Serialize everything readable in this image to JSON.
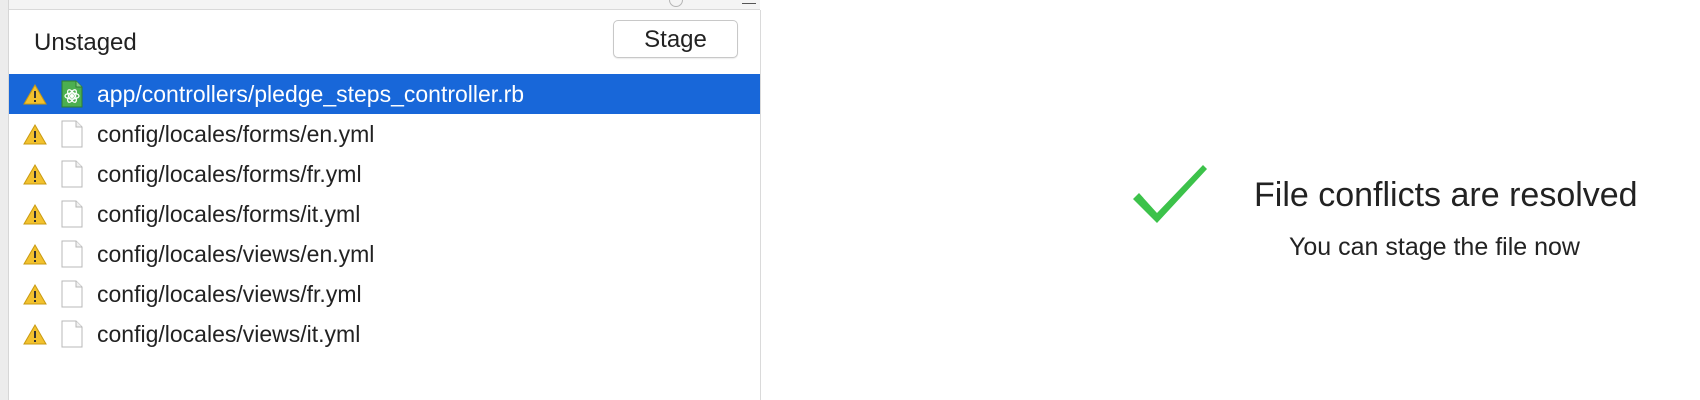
{
  "unstaged_panel": {
    "title": "Unstaged",
    "stage_button_label": "Stage",
    "files": [
      {
        "path": "app/controllers/pledge_steps_controller.rb",
        "status_icon": "warning-icon",
        "file_icon": "ruby-file-icon",
        "selected": true
      },
      {
        "path": "config/locales/forms/en.yml",
        "status_icon": "warning-icon",
        "file_icon": "file-icon",
        "selected": false
      },
      {
        "path": "config/locales/forms/fr.yml",
        "status_icon": "warning-icon",
        "file_icon": "file-icon",
        "selected": false
      },
      {
        "path": "config/locales/forms/it.yml",
        "status_icon": "warning-icon",
        "file_icon": "file-icon",
        "selected": false
      },
      {
        "path": "config/locales/views/en.yml",
        "status_icon": "warning-icon",
        "file_icon": "file-icon",
        "selected": false
      },
      {
        "path": "config/locales/views/fr.yml",
        "status_icon": "warning-icon",
        "file_icon": "file-icon",
        "selected": false
      },
      {
        "path": "config/locales/views/it.yml",
        "status_icon": "warning-icon",
        "file_icon": "file-icon",
        "selected": false
      }
    ]
  },
  "conflict_message": {
    "icon": "checkmark-icon",
    "title": "File conflicts are resolved",
    "subtitle": "You can stage the file now"
  },
  "colors": {
    "selection": "#1867d9",
    "check": "#3cc24a",
    "warning": "#f2c12e"
  }
}
